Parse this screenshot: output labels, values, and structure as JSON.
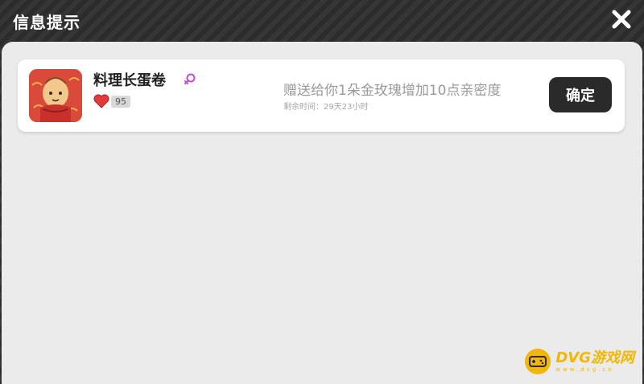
{
  "window": {
    "title": "信息提示",
    "close_icon": "close-icon"
  },
  "messages": [
    {
      "avatar_icon": "chef-character-avatar",
      "sender_name": "料理长蛋卷",
      "gender_icon": "female-symbol-icon",
      "affinity_icon": "heart-icon",
      "affinity_value": "95",
      "text": "赠送给你1朵金玫瑰增加10点亲密度",
      "remaining": "剩余时间：29天23小时",
      "confirm_label": "确定"
    }
  ],
  "watermark": {
    "title": "DVG游戏网",
    "subtitle": "www.dvg.cn"
  },
  "colors": {
    "title_bar": "#2c2c2c",
    "panel": "#ebebeb",
    "button": "#2a2a2a",
    "gender": "#c24bd6",
    "heart": "#e23b3b",
    "watermark": "#f2b705"
  }
}
